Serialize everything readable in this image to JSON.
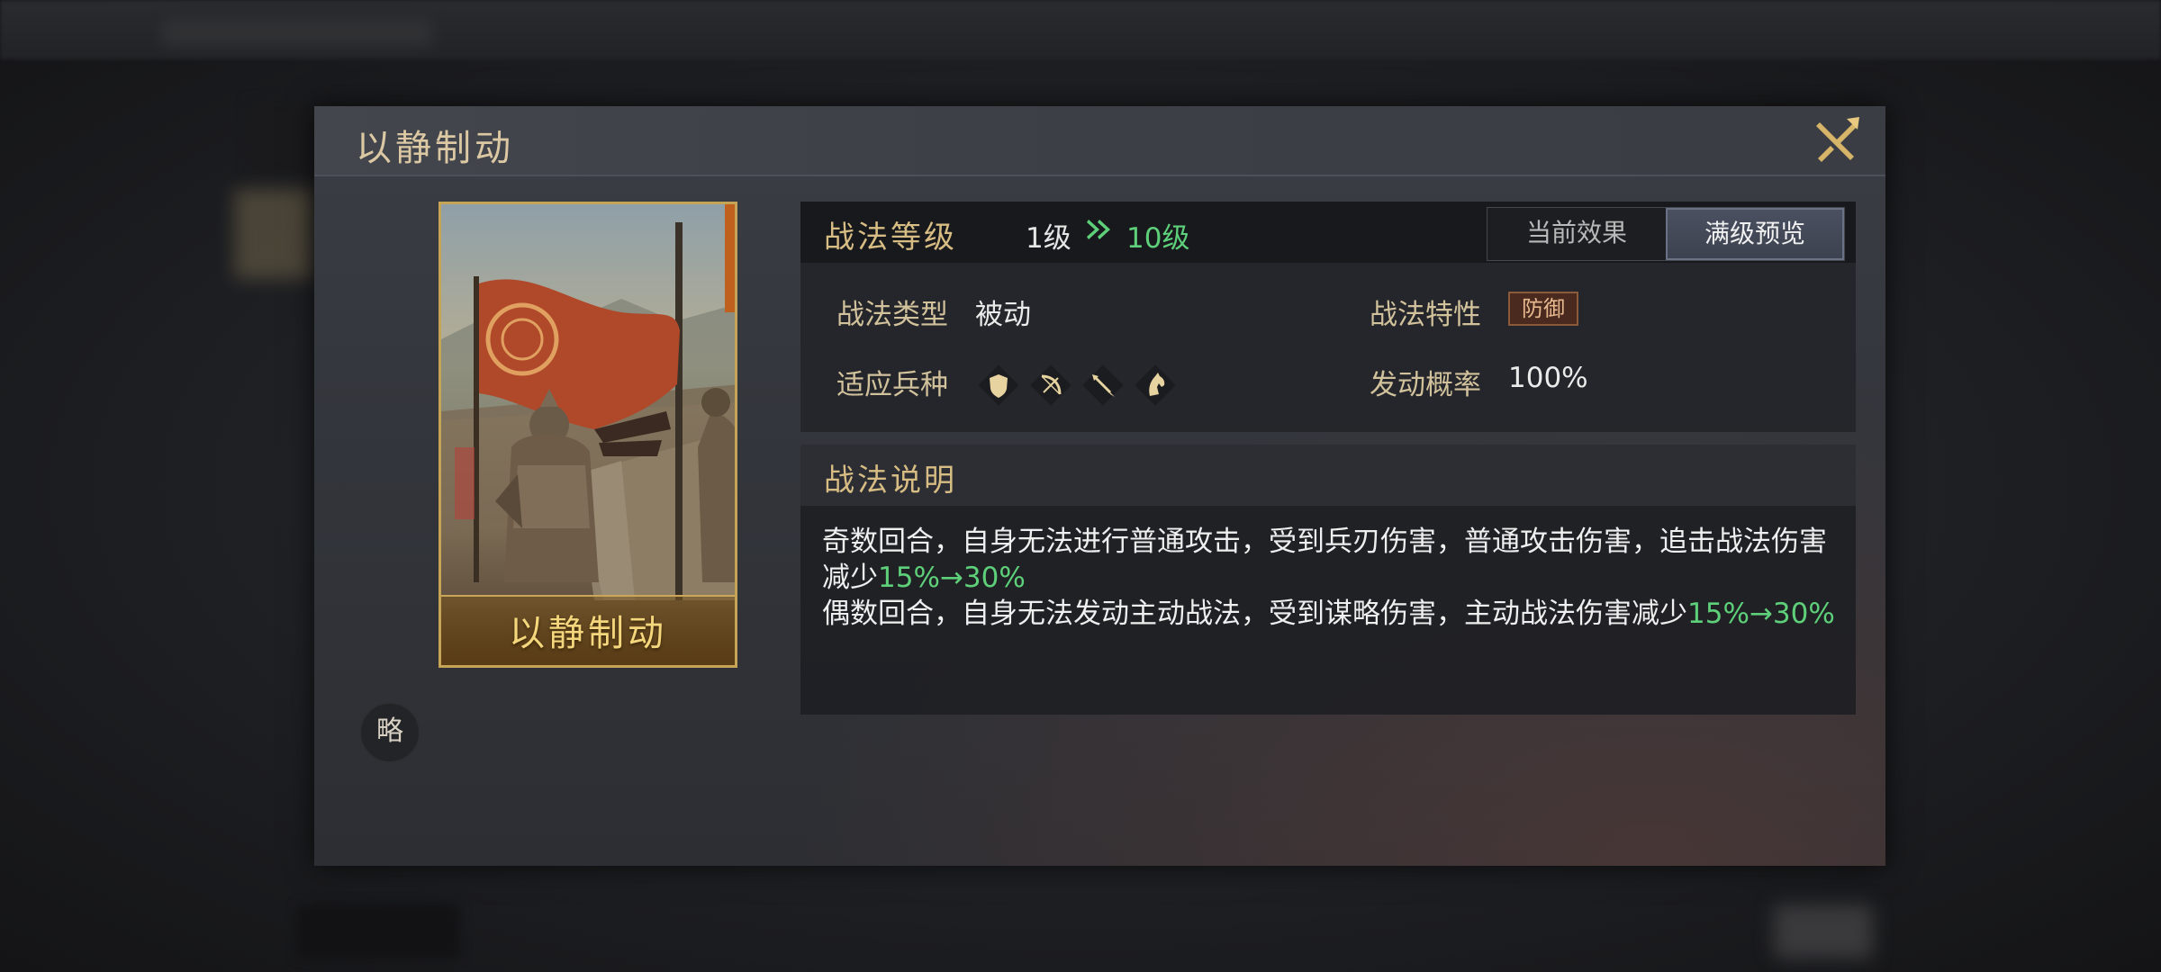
{
  "dialog": {
    "title": "以静制动",
    "card_name": "以静制动",
    "strategy_badge": "略"
  },
  "level": {
    "label": "战法等级",
    "from": "1级",
    "to": "10级"
  },
  "tabs": {
    "current": "当前效果",
    "max_preview": "满级预览",
    "selected": "满级预览"
  },
  "info": {
    "type_label": "战法类型",
    "type_value": "被动",
    "trait_label": "战法特性",
    "trait_value": "防御",
    "troops_label": "适应兵种",
    "troop_icons": [
      "shield-icon",
      "bow-icon",
      "spear-icon",
      "horse-icon"
    ],
    "rate_label": "发动概率",
    "rate_value": "100%"
  },
  "description": {
    "title": "战法说明",
    "line1_text": "奇数回合，自身无法进行普通攻击，受到兵刃伤害，普通攻击伤害，追击战法伤害减少",
    "line1_value": "15%→30%",
    "line2_text": "偶数回合，自身无法发动主动战法，受到谋略伤害，主动战法伤害减少",
    "line2_value": "15%→30%"
  },
  "colors": {
    "accent_gold": "#d7bd83",
    "upgrade_green": "#5ed07a"
  }
}
